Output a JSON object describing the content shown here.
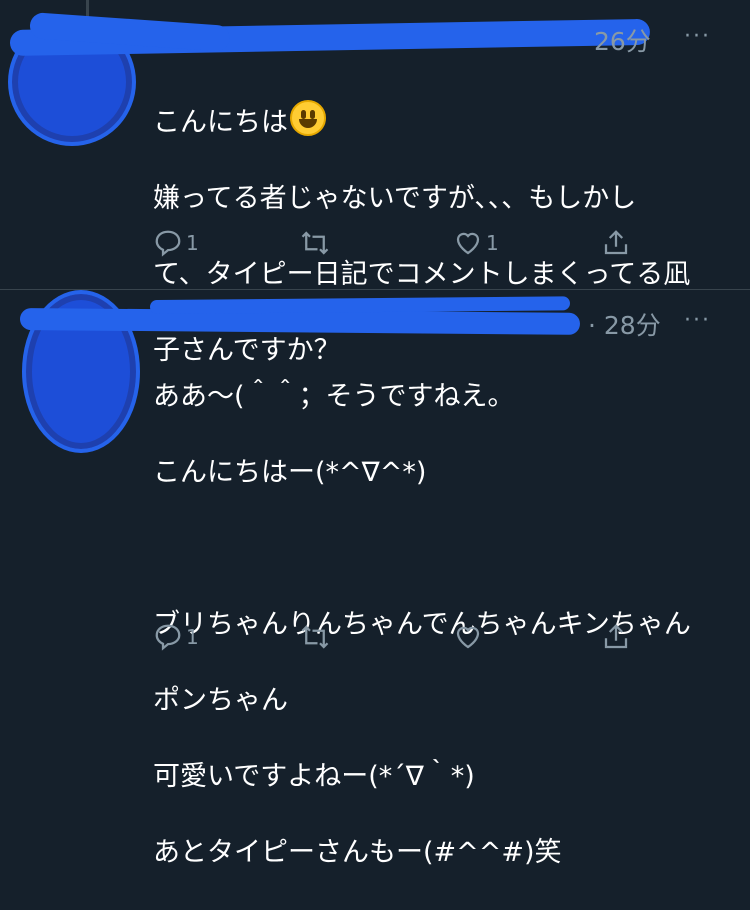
{
  "colors": {
    "background": "#15202b",
    "text": "#ffffff",
    "muted": "#8899a6",
    "scribble": "#2563eb",
    "divider": "#38444d"
  },
  "tweets": [
    {
      "time": "26分",
      "more": "···",
      "text": "こんにちは\n嫌ってる者じゃないですが、、、もしかして、タイピー日記でコメントしまくってる凪子さんですか？",
      "line1": "こんにちは",
      "line2": "嫌ってる者じゃないですが、、、もしかし",
      "line3": "て、タイピー日記でコメントしまくってる凪",
      "line4": "子さんですか？",
      "emoji": "grinning-face-emoji",
      "reply_count": "1",
      "retweet_count": "",
      "like_count": "1"
    },
    {
      "time": "· 28分",
      "more": "···",
      "lines": [
        "ああ～(＾＾；そうですねえ。",
        "こんにちはー(*^∇^*)",
        "",
        "ブリちゃんりんちゃんでんちゃんキンちゃん",
        "ポンちゃん",
        "可愛いですよねー(*´∇｀*)",
        "あとタイピーさんもー(#^^#)笑"
      ],
      "reply_count": "1",
      "retweet_count": "",
      "like_count": ""
    }
  ],
  "icons": [
    "reply-icon",
    "retweet-icon",
    "like-icon",
    "share-icon",
    "more-icon"
  ]
}
